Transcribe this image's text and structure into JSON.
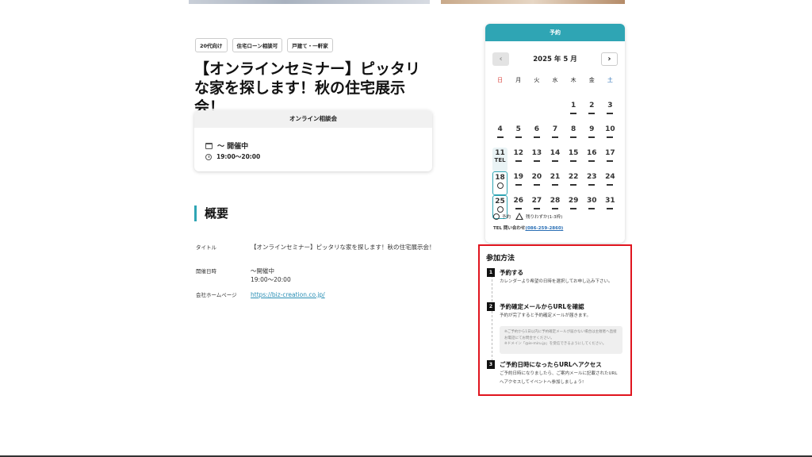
{
  "tags": [
    "20代向け",
    "住宅ローン相談可",
    "戸建て・一軒家"
  ],
  "title": "【オンラインセミナー】ピッタリな家を探します！秋の住宅展示会！",
  "event_card": {
    "header": "オンライン相談会",
    "date_text": "〜 開催中",
    "time_text": "19:00〜20:00"
  },
  "overview": {
    "heading": "概要",
    "rows": [
      {
        "label": "タイトル",
        "value": "【オンラインセミナー】ピッタリな家を探します！秋の住宅展示会！"
      },
      {
        "label": "開催日時",
        "value": "〜開催中",
        "value2": "19:00〜20:00"
      },
      {
        "label": "会社ホームページ",
        "value": "https://biz-creation.co.jp/"
      }
    ]
  },
  "reservation": {
    "header": "予約",
    "month_label": "2025 年 5 月",
    "prev_icon": "chevron-left-icon",
    "next_icon": "chevron-right-icon",
    "weekdays": [
      "日",
      "月",
      "火",
      "水",
      "木",
      "金",
      "土"
    ],
    "days": [
      {
        "d": "",
        "s": ""
      },
      {
        "d": "",
        "s": ""
      },
      {
        "d": "",
        "s": ""
      },
      {
        "d": "",
        "s": ""
      },
      {
        "d": "1",
        "s": "dash"
      },
      {
        "d": "2",
        "s": "dash"
      },
      {
        "d": "3",
        "s": "dash"
      },
      {
        "d": "4",
        "s": "dash"
      },
      {
        "d": "5",
        "s": "dash"
      },
      {
        "d": "6",
        "s": "dash"
      },
      {
        "d": "7",
        "s": "dash"
      },
      {
        "d": "8",
        "s": "dash"
      },
      {
        "d": "9",
        "s": "dash"
      },
      {
        "d": "10",
        "s": "dash"
      },
      {
        "d": "11",
        "s": "TEL"
      },
      {
        "d": "12",
        "s": "dash"
      },
      {
        "d": "13",
        "s": "dash"
      },
      {
        "d": "14",
        "s": "dash"
      },
      {
        "d": "15",
        "s": "dash"
      },
      {
        "d": "16",
        "s": "dash"
      },
      {
        "d": "17",
        "s": "dash"
      },
      {
        "d": "18",
        "s": "○"
      },
      {
        "d": "19",
        "s": "dash"
      },
      {
        "d": "20",
        "s": "dash"
      },
      {
        "d": "21",
        "s": "dash"
      },
      {
        "d": "22",
        "s": "dash"
      },
      {
        "d": "23",
        "s": "dash"
      },
      {
        "d": "24",
        "s": "dash"
      },
      {
        "d": "25",
        "s": "○"
      },
      {
        "d": "26",
        "s": "dash"
      },
      {
        "d": "27",
        "s": "dash"
      },
      {
        "d": "28",
        "s": "dash"
      },
      {
        "d": "29",
        "s": "dash"
      },
      {
        "d": "30",
        "s": "dash"
      },
      {
        "d": "31",
        "s": "dash"
      }
    ],
    "legend_available": "予約",
    "legend_few": "残りわずか(1-3枠)",
    "tel_label": "TEL 問い合わせ",
    "tel_number": "(086-259-2860)"
  },
  "participation": {
    "title": "参加方法",
    "steps": [
      {
        "num": "1",
        "title": "予約する",
        "body": "カレンダーより希望の日時を選択してお申し込み下さい。"
      },
      {
        "num": "2",
        "title": "予約確定メールからURLを確認",
        "body": "予約が完了すると予約確定メールが届きます。"
      },
      {
        "num": "3",
        "title": "ご予約日時になったらURLへアクセス",
        "body": "ご予約日時になりましたら、ご案内メールに記載されたURLへアクセスしてイベントへ参加しましょう!"
      }
    ],
    "note_line1": "※ご予約から1日以内に予約確定メールが届かない場合は主催者へ直接お電話にてお問合せください。",
    "note_line2": "※ドメイン「@ie-miru.jp」を受信できるようにしてください。"
  }
}
